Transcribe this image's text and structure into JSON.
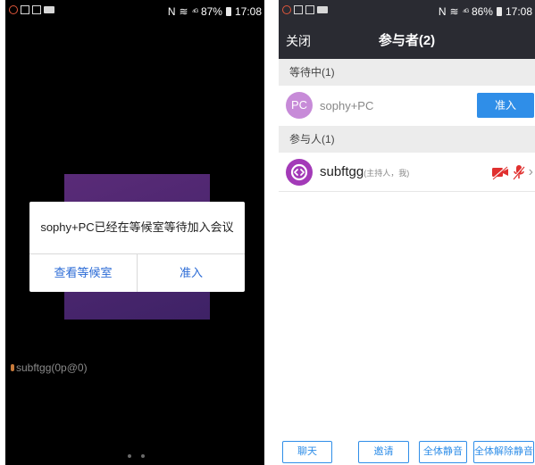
{
  "left": {
    "status": {
      "signal": "⁴ᴳ",
      "battery": "87%",
      "time": "17:08"
    },
    "dialog": {
      "message": "sophy+PC已经在等候室等待加入会议",
      "view_button": "查看等候室",
      "admit_button": "准入"
    },
    "video_label": "subftgg(0p@0)",
    "colors": {
      "tile": "#4a2570",
      "dialog_button": "#2b6bd6"
    }
  },
  "right": {
    "status": {
      "signal": "⁴ᴳ",
      "battery": "86%",
      "time": "17:08"
    },
    "header": {
      "close": "关闭",
      "title": "参与者(2)"
    },
    "waiting_section": {
      "label": "等待中(1)",
      "user": {
        "avatar_initials": "PC",
        "name": "sophy+PC",
        "action": "准入"
      }
    },
    "participants_section": {
      "label": "参与人(1)",
      "user": {
        "name": "subftgg",
        "role": "(主持人，我)",
        "icons": [
          "video-off-icon",
          "mic-muted-icon",
          "chevron-right-icon"
        ]
      }
    },
    "bottom": {
      "chat": "聊天",
      "invite": "邀请",
      "mute_all": "全体静音",
      "unmute_all": "全体解除静音"
    },
    "colors": {
      "accent": "#2f8ee8",
      "header": "#2a2b32",
      "avatar_pc": "#c78bd8",
      "avatar_host": "#a33ab8",
      "muted": "#e0302f"
    }
  }
}
